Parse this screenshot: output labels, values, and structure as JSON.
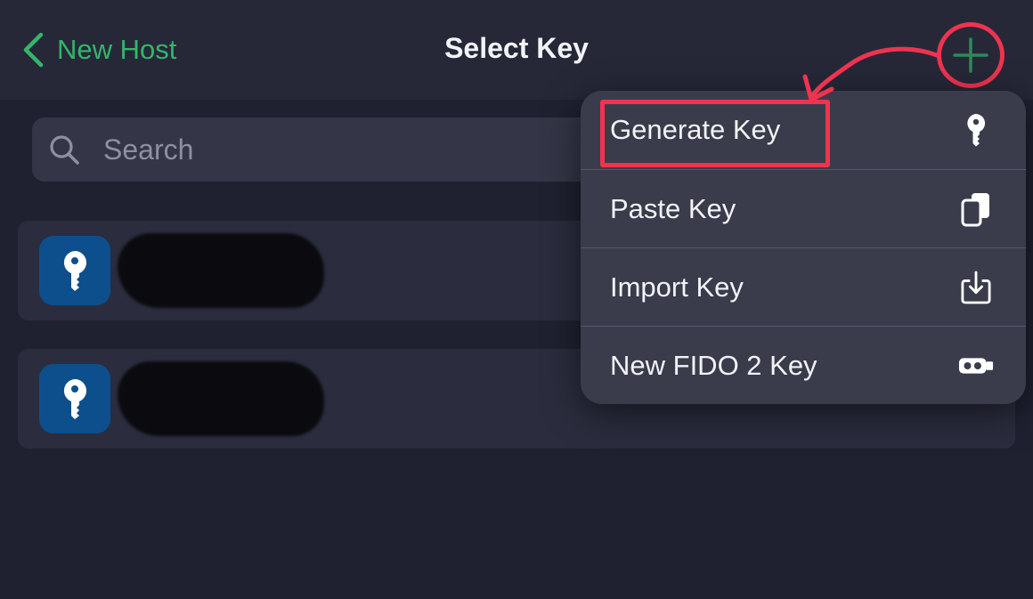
{
  "nav": {
    "back_label": "New Host",
    "title": "Select Key",
    "add_icon": "plus-icon"
  },
  "search": {
    "placeholder": "Search",
    "value": ""
  },
  "keys": [
    {
      "icon": "key-icon",
      "name": "[redacted]"
    },
    {
      "icon": "key-icon",
      "name": "[redacted]"
    }
  ],
  "menu": {
    "items": [
      {
        "label": "Generate Key",
        "icon": "key-icon"
      },
      {
        "label": "Paste Key",
        "icon": "clipboard-icon"
      },
      {
        "label": "Import Key",
        "icon": "import-icon"
      },
      {
        "label": "New FIDO 2 Key",
        "icon": "security-key-icon"
      }
    ]
  },
  "colors": {
    "accent": "#33b56a",
    "annotation": "#f0334f",
    "key_tile": "#0d4f8c",
    "background": "#1f2131"
  }
}
